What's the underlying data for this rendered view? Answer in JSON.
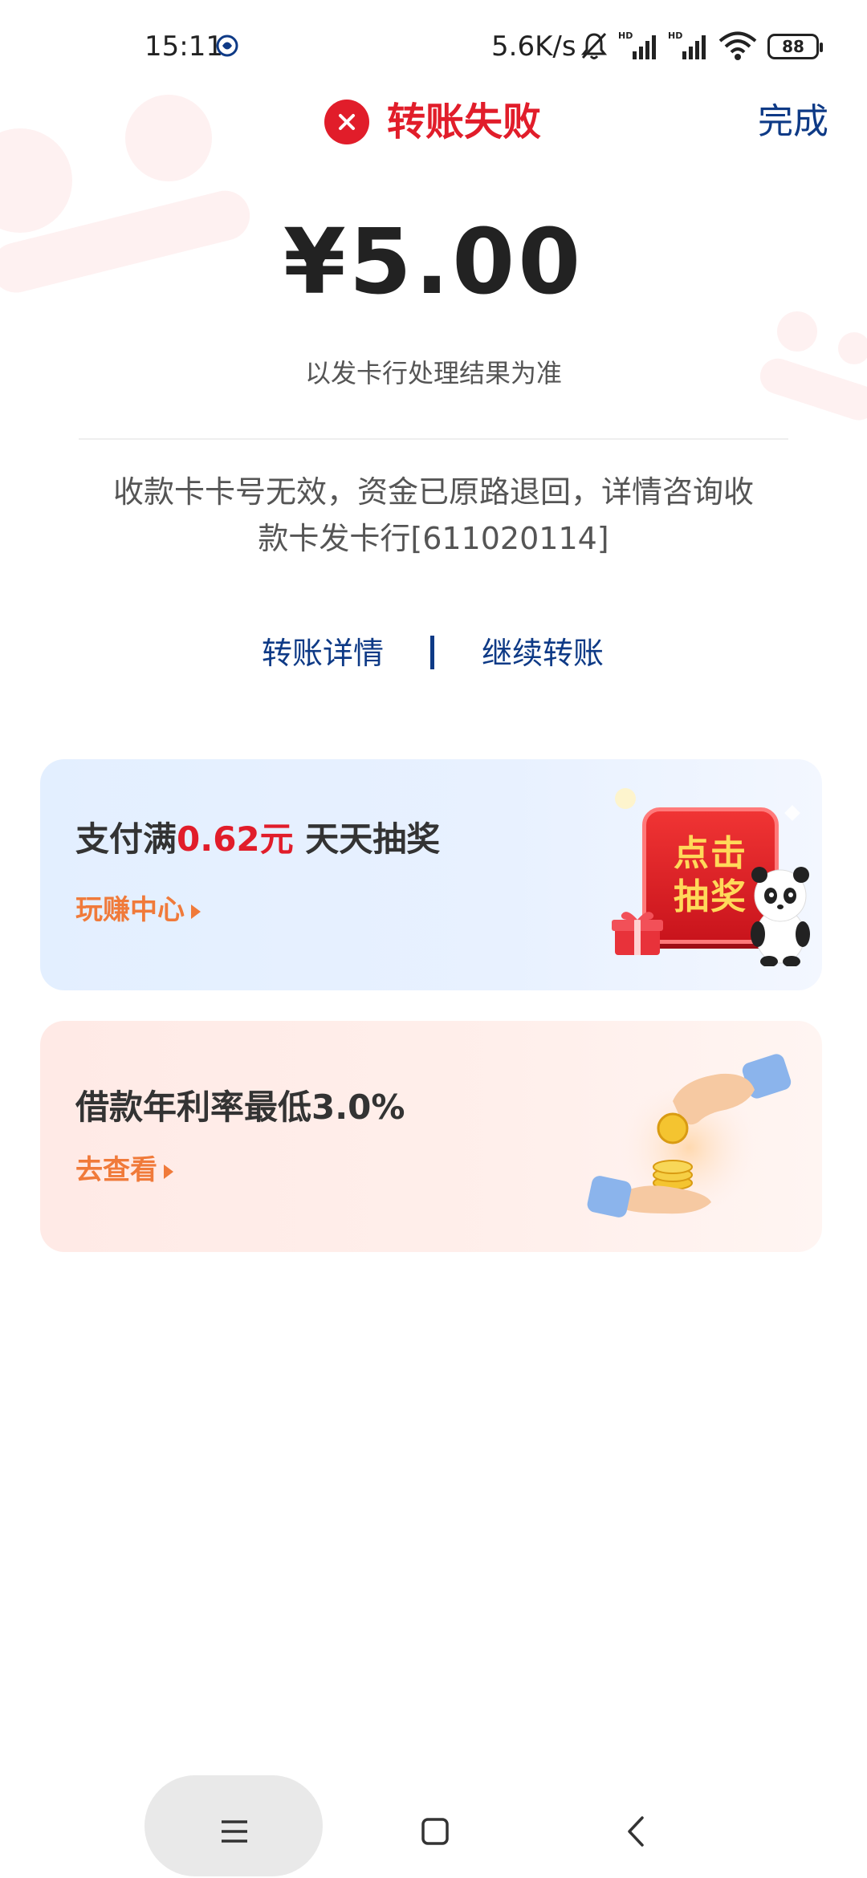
{
  "status_bar": {
    "time": "15:11",
    "network_speed": "5.6K/s",
    "battery_level": "88",
    "icons": [
      "mute-bell-icon",
      "signal-hd-icon",
      "signal-hd-icon",
      "wifi-icon",
      "battery-icon"
    ]
  },
  "header": {
    "title": "转账失败",
    "done_label": "完成",
    "status_icon": "close-circle-icon",
    "status_color": "#e11d2a"
  },
  "transfer": {
    "amount": "¥5.00",
    "note": "以发卡行处理结果为准",
    "fail_reason": "收款卡卡号无效，资金已原路退回，详情咨询收款卡发卡行[611020114]"
  },
  "actions": {
    "details_label": "转账详情",
    "continue_label": "继续转账",
    "link_color": "#0e3a86"
  },
  "promos": [
    {
      "title_prefix": "支付满",
      "title_highlight": "0.62元",
      "title_suffix": " 天天抽奖",
      "link_label": "玩赚中心",
      "button_line1": "点击",
      "button_line2": "抽奖"
    },
    {
      "title": "借款年利率最低3.0%",
      "link_label": "去查看"
    }
  ],
  "nav": {
    "icons": [
      "menu-icon",
      "home-square-icon",
      "back-chevron-icon"
    ]
  }
}
